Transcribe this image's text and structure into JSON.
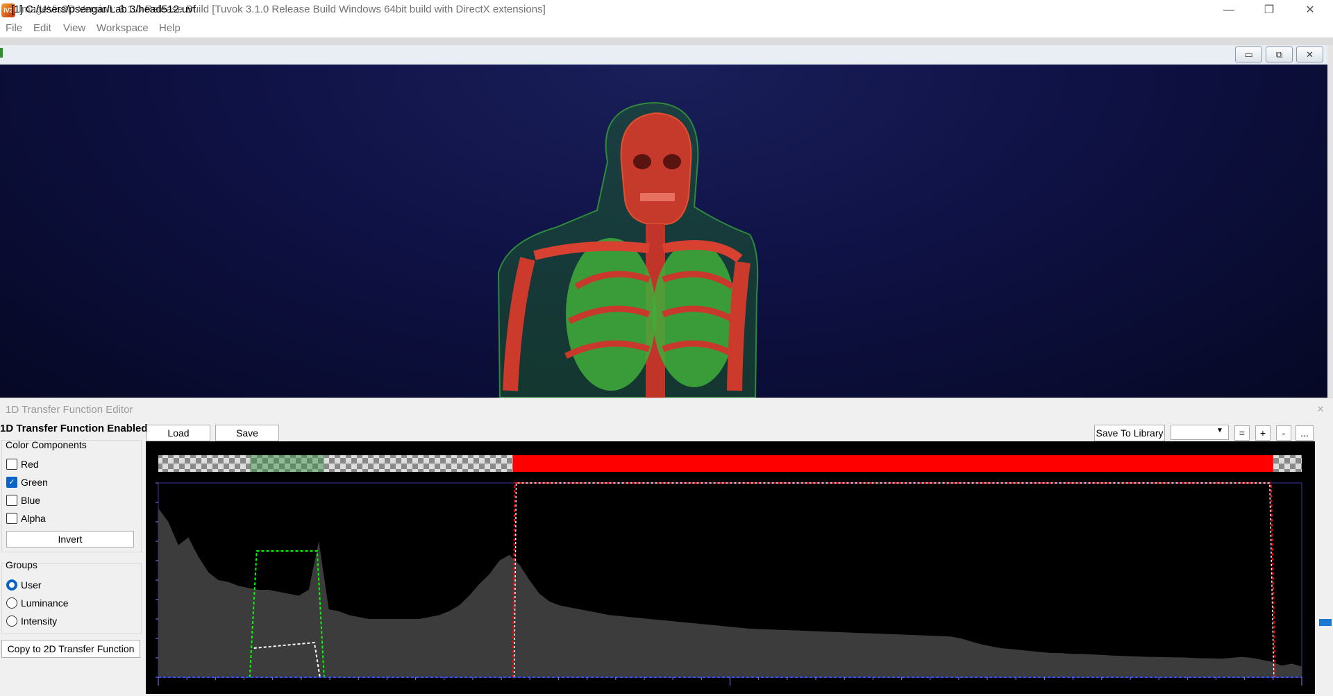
{
  "window": {
    "title": "ImageVis3D Version: 3.1.0 Release Build [Tuvok 3.1.0 Release Build Windows 64bit build with DirectX extensions]",
    "icon_text": "IV3",
    "minimize_glyph": "—",
    "restore_glyph": "❐",
    "close_glyph": "✕"
  },
  "menu": [
    "File",
    "Edit",
    "View",
    "Workspace",
    "Help"
  ],
  "subwindow": {
    "title": "[1] C:/Users/psengar/Lab 3/head512.uvf",
    "btn_min": "▭",
    "btn_restore": "⧉",
    "btn_close": "✕"
  },
  "tf_editor": {
    "dock_title": "1D Transfer Function Editor",
    "dock_close": "✕",
    "enabled_label": "1D Transfer Function Enabled",
    "load_label": "Load",
    "save_label": "Save",
    "save_to_library_label": "Save To Library",
    "library_selected": "",
    "equal_label": "=",
    "plus_label": "+",
    "minus_label": "-",
    "more_label": "...",
    "color_components": {
      "title": "Color Components",
      "items": [
        {
          "label": "Red",
          "checked": false
        },
        {
          "label": "Green",
          "checked": true
        },
        {
          "label": "Blue",
          "checked": false
        },
        {
          "label": "Alpha",
          "checked": false
        }
      ],
      "invert_label": "Invert"
    },
    "groups": {
      "title": "Groups",
      "items": [
        {
          "label": "User",
          "selected": true
        },
        {
          "label": "Luminance",
          "selected": false
        },
        {
          "label": "Intensity",
          "selected": false
        }
      ]
    },
    "copy_label": "Copy to 2D Transfer Function"
  },
  "colors": {
    "viewport_bg": "#0f1245",
    "red_curve": "#ff0000",
    "green_curve": "#00ff00",
    "histogram": "#3c3c3c",
    "accent": "#0a64c8"
  },
  "transfer_function": {
    "histogram_bins": [
      0.87,
      0.8,
      0.68,
      0.72,
      0.62,
      0.54,
      0.5,
      0.49,
      0.47,
      0.46,
      0.45,
      0.45,
      0.44,
      0.43,
      0.42,
      0.45,
      0.7,
      0.35,
      0.34,
      0.32,
      0.31,
      0.3,
      0.3,
      0.3,
      0.3,
      0.3,
      0.3,
      0.31,
      0.32,
      0.34,
      0.37,
      0.42,
      0.48,
      0.53,
      0.6,
      0.63,
      0.58,
      0.5,
      0.43,
      0.39,
      0.37,
      0.36,
      0.35,
      0.34,
      0.33,
      0.32,
      0.315,
      0.31,
      0.305,
      0.3,
      0.295,
      0.29,
      0.285,
      0.28,
      0.275,
      0.27,
      0.265,
      0.26,
      0.255,
      0.25,
      0.248,
      0.246,
      0.244,
      0.242,
      0.24,
      0.238,
      0.236,
      0.234,
      0.232,
      0.23,
      0.228,
      0.226,
      0.224,
      0.222,
      0.22,
      0.218,
      0.216,
      0.214,
      0.212,
      0.21,
      0.2,
      0.185,
      0.17,
      0.16,
      0.15,
      0.145,
      0.14,
      0.135,
      0.13,
      0.125,
      0.125,
      0.12,
      0.12,
      0.118,
      0.115,
      0.112,
      0.11,
      0.108,
      0.106,
      0.105,
      0.104,
      0.103,
      0.102,
      0.1,
      0.098,
      0.097,
      0.096,
      0.1,
      0.105,
      0.1,
      0.09,
      0.08,
      0.06,
      0.07,
      0.055
    ],
    "green_range": [
      0.08,
      0.145
    ],
    "green_level": 0.65,
    "red_range": [
      0.31,
      0.975
    ],
    "red_level": 1.0
  }
}
